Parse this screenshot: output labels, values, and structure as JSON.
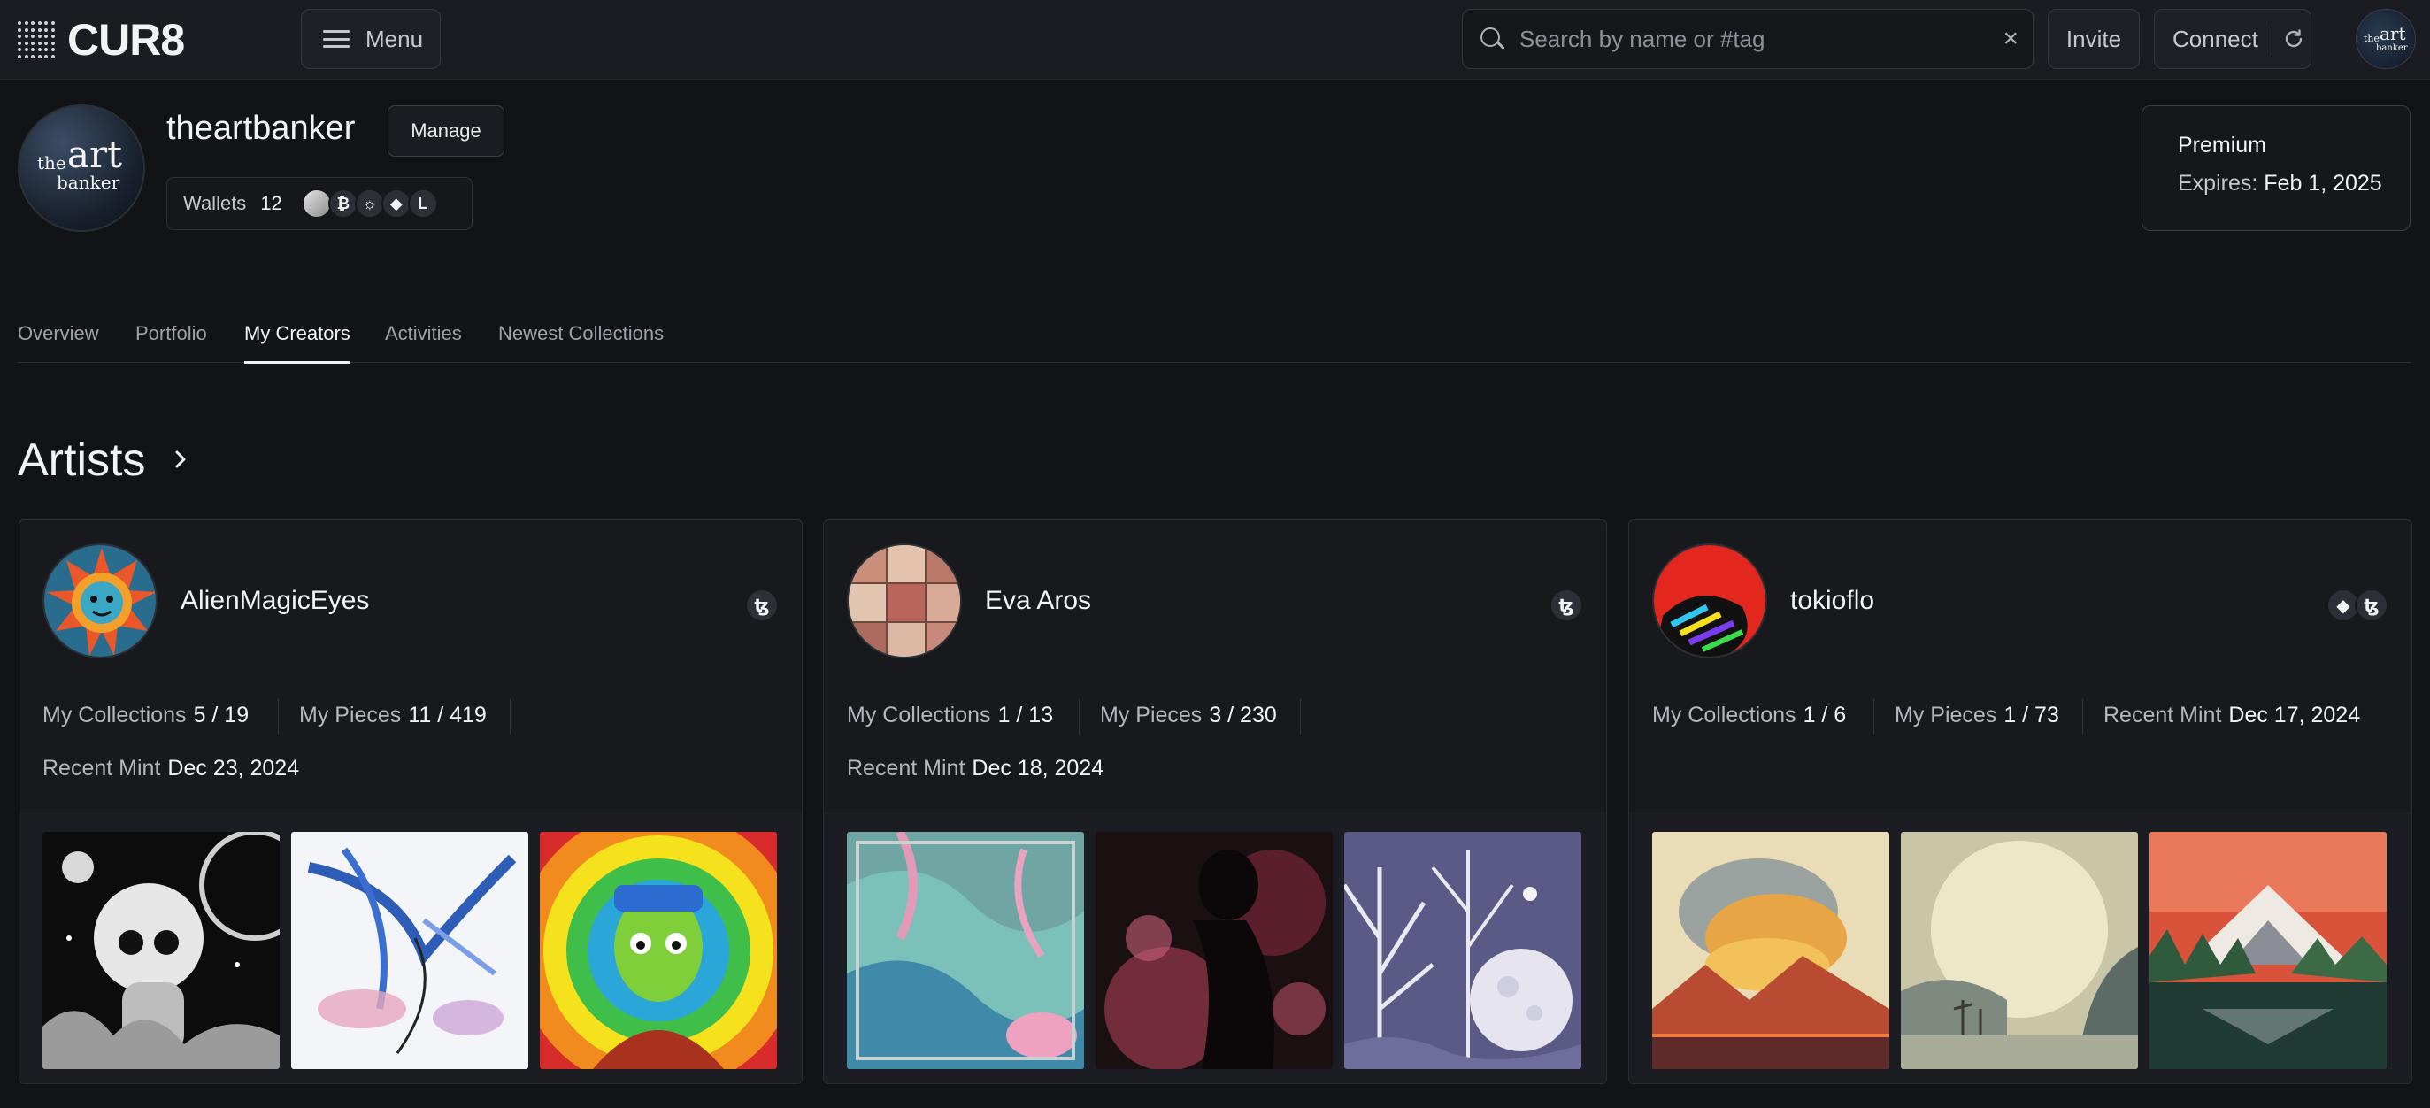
{
  "header": {
    "logo_text": "CUR8",
    "menu_label": "Menu",
    "search_placeholder": "Search by name or #tag",
    "search_value": "",
    "invite_label": "Invite",
    "connect_label": "Connect"
  },
  "profile": {
    "avatar_words": [
      "the",
      "art",
      "banker"
    ],
    "username": "theartbanker",
    "manage_label": "Manage",
    "wallets_label": "Wallets",
    "wallets_count": "12",
    "chain_icons": [
      "coin-icon",
      "bitcoin-icon",
      "sun-chain-icon",
      "ethereum-icon",
      "l-chain-icon"
    ],
    "premium": {
      "title": "Premium",
      "expires_label": "Expires:",
      "expires_value": "Feb 1, 2025"
    }
  },
  "tabs": [
    {
      "label": "Overview",
      "active": false
    },
    {
      "label": "Portfolio",
      "active": false
    },
    {
      "label": "My Creators",
      "active": true
    },
    {
      "label": "Activities",
      "active": false
    },
    {
      "label": "Newest Collections",
      "active": false
    }
  ],
  "section": {
    "title": "Artists"
  },
  "artists": [
    {
      "name": "AlienMagicEyes",
      "chains": [
        "tezos-icon"
      ],
      "stats": [
        {
          "label": "My Collections",
          "value": "5 / 19"
        },
        {
          "label": "My Pieces",
          "value": "11 / 419"
        },
        {
          "label": "Recent Mint",
          "value": "Dec 23, 2024"
        }
      ]
    },
    {
      "name": "Eva Aros",
      "chains": [
        "tezos-icon"
      ],
      "stats": [
        {
          "label": "My Collections",
          "value": "1 / 13"
        },
        {
          "label": "My Pieces",
          "value": "3 / 230"
        },
        {
          "label": "Recent Mint",
          "value": "Dec 18, 2024"
        }
      ]
    },
    {
      "name": "tokioflo",
      "chains": [
        "ethereum-icon",
        "tezos-icon"
      ],
      "stats": [
        {
          "label": "My Collections",
          "value": "1 / 6"
        },
        {
          "label": "My Pieces",
          "value": "1 / 73"
        },
        {
          "label": "Recent Mint",
          "value": "Dec 17, 2024"
        }
      ]
    }
  ],
  "colors": {
    "background": "#111317",
    "topbar": "#1a1c21",
    "card": "#17191d",
    "text_primary": "#f2f3f5",
    "text_muted": "#b4b7bd"
  }
}
